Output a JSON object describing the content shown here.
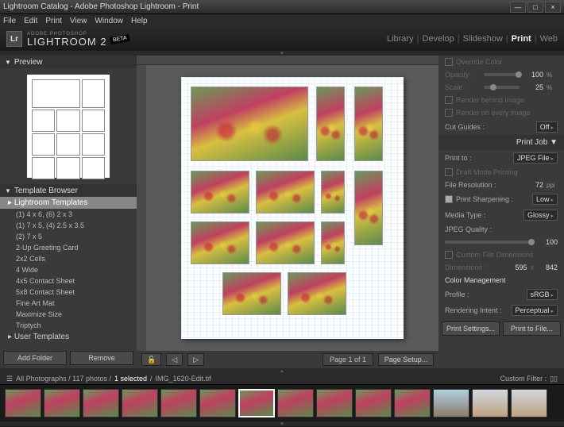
{
  "window": {
    "title": "Lightroom Catalog - Adobe Photoshop Lightroom - Print",
    "minimize": "—",
    "maximize": "□",
    "close": "×"
  },
  "menu": [
    "File",
    "Edit",
    "Print",
    "View",
    "Window",
    "Help"
  ],
  "app": {
    "small": "ADOBE PHOTOSHOP",
    "big": "LIGHTROOM 2",
    "beta": "BETA"
  },
  "modules": {
    "items": [
      "Library",
      "Develop",
      "Slideshow",
      "Print",
      "Web"
    ],
    "active": "Print"
  },
  "left": {
    "preview_title": "Preview",
    "template_title": "Template Browser",
    "groups": {
      "lightroom": "Lightroom Templates",
      "user": "User Templates"
    },
    "templates": [
      "(1) 4 x 6, (6) 2 x 3",
      "(1) 7 x 5, (4) 2.5 x 3.5",
      "(2) 7 x 5",
      "2-Up Greeting Card",
      "2x2 Cells",
      "4 Wide",
      "4x5 Contact Sheet",
      "5x8 Contact Sheet",
      "Fine Art Mat",
      "Maximize Size",
      "Triptych"
    ],
    "add_folder": "Add Folder",
    "remove": "Remove"
  },
  "center": {
    "page_info": "Page 1 of 1",
    "page_setup": "Page Setup...",
    "lock_icon": "🔓"
  },
  "right": {
    "override_color": "Override Color",
    "opacity_label": "Opacity :",
    "opacity_val": "100",
    "scale_label": "Scale :",
    "scale_val": "25",
    "pct": "%",
    "render_behind": "Render behind image",
    "render_every": "Render on every image",
    "cut_guides": "Cut Guides :",
    "cut_guides_val": "Off",
    "print_job": "Print Job",
    "print_to": "Print to :",
    "print_to_val": "JPEG File",
    "draft": "Draft Mode Printing",
    "file_res": "File Resolution :",
    "file_res_val": "72",
    "ppi": "ppi",
    "sharpen": "Print Sharpening :",
    "sharpen_val": "Low",
    "media": "Media Type :",
    "media_val": "Glossy",
    "jpeg_q": "JPEG Quality :",
    "jpeg_q_val": "100",
    "custom_dim": "Custom File Dimensions",
    "dim_label": "Dimensions :",
    "dim_w": "595",
    "dim_x": "x",
    "dim_h": "842",
    "color_mgmt": "Color Management",
    "profile": "Profile :",
    "profile_val": "sRGB",
    "intent": "Rendering Intent :",
    "intent_val": "Perceptual",
    "print_settings": "Print Settings...",
    "print_to_file": "Print to File..."
  },
  "filmstrip": {
    "icon": "☰",
    "path": "All Photographs / 117 photos /",
    "selected": "1 selected",
    "sep": "/",
    "file": "IMG_1620-Edit.tif",
    "custom_filter": "Custom Filter :",
    "filter_icons": "▯▯"
  }
}
